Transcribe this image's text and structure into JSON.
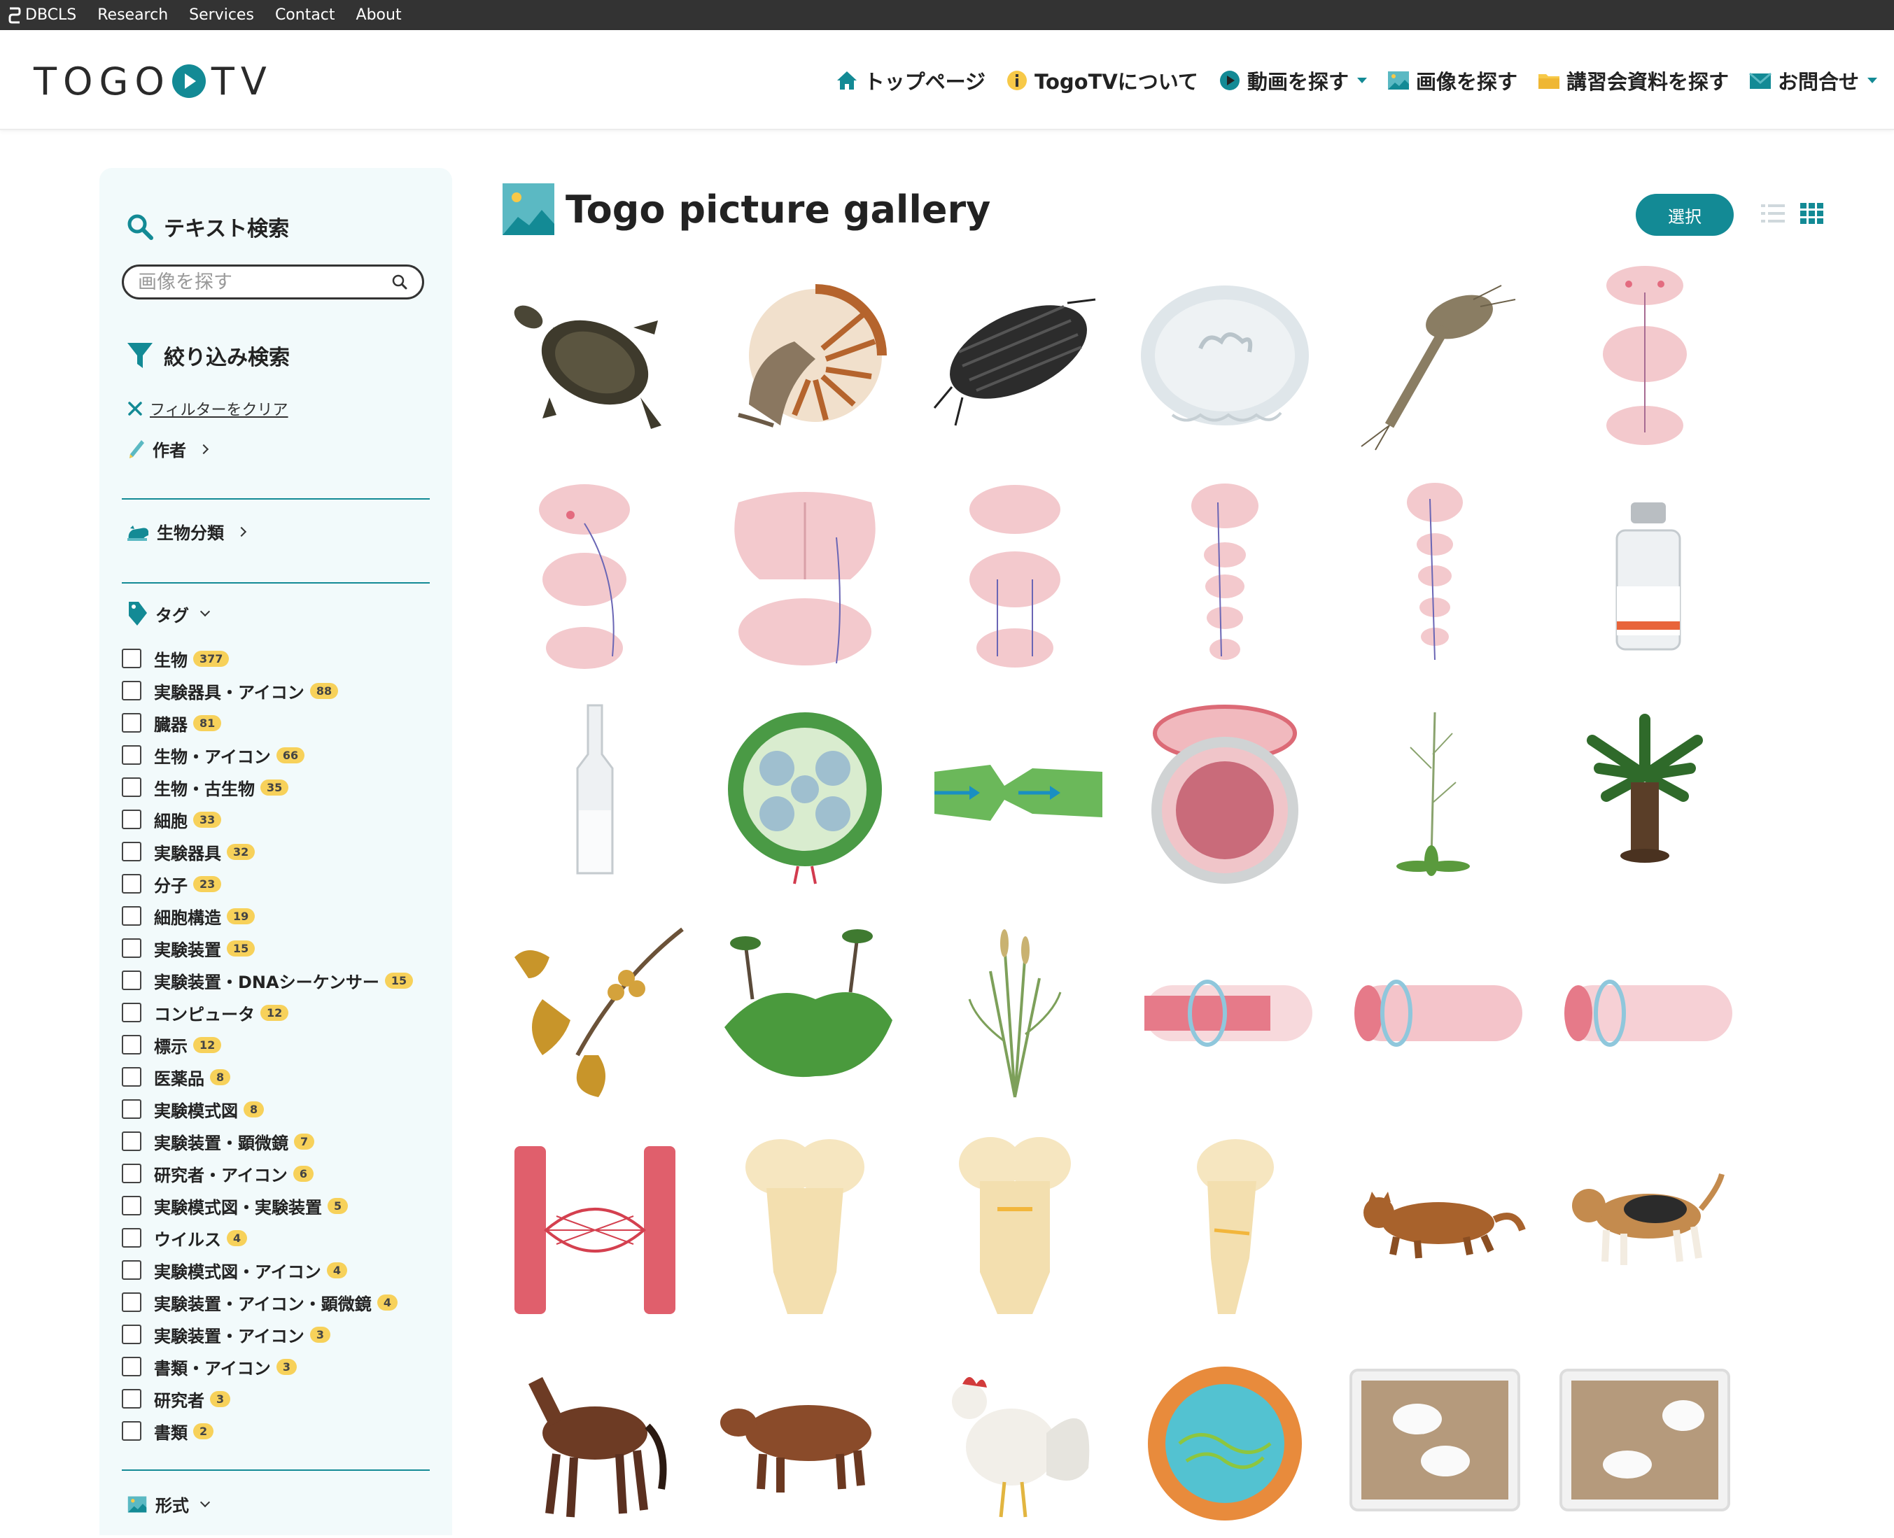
{
  "topbar": {
    "org": "DBCLS",
    "links": [
      "Research",
      "Services",
      "Contact",
      "About"
    ]
  },
  "header": {
    "logo_left": "TOGO",
    "logo_right": "TV",
    "nav": [
      {
        "label": "トップページ",
        "icon": "home-icon"
      },
      {
        "label": "TogoTVについて",
        "icon": "info-icon"
      },
      {
        "label": "動画を探す",
        "icon": "play-icon",
        "dropdown": true
      },
      {
        "label": "画像を探す",
        "icon": "image-icon"
      },
      {
        "label": "講習会資料を探す",
        "icon": "folder-icon"
      },
      {
        "label": "お問合せ",
        "icon": "mail-icon",
        "dropdown": true
      }
    ]
  },
  "sidebar": {
    "text_search_title": "テキスト検索",
    "search_placeholder": "画像を探す",
    "filter_title": "絞り込み検索",
    "clear_filter": "フィルターをクリア",
    "author": "作者",
    "taxonomy": "生物分類",
    "tag_title": "タグ",
    "format_title": "形式",
    "tags": [
      {
        "name": "生物",
        "count": "377"
      },
      {
        "name": "実験器具・アイコン",
        "count": "88"
      },
      {
        "name": "臓器",
        "count": "81"
      },
      {
        "name": "生物・アイコン",
        "count": "66"
      },
      {
        "name": "生物・古生物",
        "count": "35"
      },
      {
        "name": "細胞",
        "count": "33"
      },
      {
        "name": "実験器具",
        "count": "32"
      },
      {
        "name": "分子",
        "count": "23"
      },
      {
        "name": "細胞構造",
        "count": "19"
      },
      {
        "name": "実験装置",
        "count": "15"
      },
      {
        "name": "実験装置・DNAシーケンサー",
        "count": "15"
      },
      {
        "name": "コンピュータ",
        "count": "12"
      },
      {
        "name": "標示",
        "count": "12"
      },
      {
        "name": "医薬品",
        "count": "8"
      },
      {
        "name": "実験模式図",
        "count": "8"
      },
      {
        "name": "実験装置・顕微鏡",
        "count": "7"
      },
      {
        "name": "研究者・アイコン",
        "count": "6"
      },
      {
        "name": "実験模式図・実験装置",
        "count": "5"
      },
      {
        "name": "ウイルス",
        "count": "4"
      },
      {
        "name": "実験模式図・アイコン",
        "count": "4"
      },
      {
        "name": "実験装置・アイコン・顕微鏡",
        "count": "4"
      },
      {
        "name": "実験装置・アイコン",
        "count": "3"
      },
      {
        "name": "書類・アイコン",
        "count": "3"
      },
      {
        "name": "研究者",
        "count": "3"
      },
      {
        "name": "書類",
        "count": "2"
      }
    ]
  },
  "main": {
    "title": "Togo picture gallery",
    "select_button": "選択",
    "images": [
      "turtle-image",
      "nautilus-image",
      "pill-bug-image",
      "jellyfish-image",
      "triops-image",
      "brainstem-sections-image",
      "brainstem-sections-2-image",
      "medulla-section-image",
      "brainstem-sections-3-image",
      "neural-pathway-image",
      "neural-pathway-2-image",
      "vial-image",
      "ampoule-image",
      "plant-stem-section-image",
      "plant-vessel-image",
      "artery-section-image",
      "arabidopsis-image",
      "cycad-image",
      "ginkgo-image",
      "liverwort-image",
      "wheat-image",
      "blood-vessel-image",
      "blood-vessel-2-image",
      "blood-vessel-3-image",
      "capillary-network-image",
      "brainstem-dorsal-image",
      "brainstem-ventral-image",
      "brainstem-lateral-image",
      "cat-image",
      "beagle-image",
      "horse-image",
      "cow-image",
      "chicken-image",
      "lipid-nanoparticle-image",
      "mice-cage-image",
      "mice-cage-2-image"
    ]
  }
}
